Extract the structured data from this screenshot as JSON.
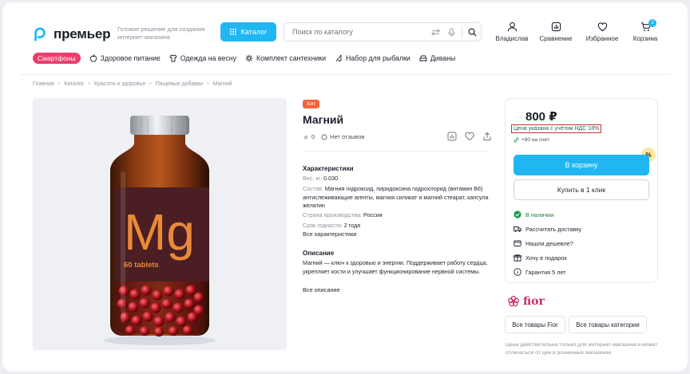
{
  "header": {
    "brand": "премьер",
    "tagline": "Готовое решение для создания интернет-магазина",
    "catalog_label": "Каталог",
    "search_placeholder": "Поиск по каталогу",
    "actions": {
      "profile": "Владислав",
      "compare": "Сравнение",
      "favorites": "Избранное",
      "cart": "Корзина",
      "cart_count": "2"
    }
  },
  "nav": {
    "items": [
      "Смартфоны",
      "Здоровое питание",
      "Одежда на весну",
      "Комплект сантехники",
      "Набор для рыбалки",
      "Диваны"
    ]
  },
  "breadcrumbs": [
    "Главная",
    "Каталог",
    "Красота и здоровье",
    "Пищевые добавки",
    "Магний"
  ],
  "image": {
    "label_big": "Mg",
    "label_small": "60 tablets"
  },
  "product": {
    "badge": "Хит",
    "title": "Магний",
    "rating": "0",
    "reviews": "Нет отзывов",
    "specs_title": "Характеристики",
    "specs": {
      "weight_k": "Вес, кг:",
      "weight_v": "0.030",
      "composition_k": "Состав:",
      "composition_v": "Магния гидроксид, пиридоксина гидрохлорид (витамин B6) антислеживающие агенты, магния силикат и магний стеарат, капсула желатин",
      "country_k": "Страна производства:",
      "country_v": "Россия",
      "shelf_k": "Срок годности:",
      "shelf_v": "2 года"
    },
    "all_specs": "Все характеристики",
    "description_title": "Описание",
    "description": "Магний — ключ к здоровью и энергии. Поддерживает работу сердца, укрепляет кости и улучшает функционирование нервной системы.",
    "all_description": "Все описание"
  },
  "buy": {
    "dots": "···",
    "price": "800 ₽",
    "vat_note": "Цена указана с учётом НДС 18%",
    "bonus": "+80 на счет",
    "discount_icon": "%",
    "add_to_cart": "В корзину",
    "one_click": "Купить в 1 клик",
    "features": [
      "В наличии",
      "Рассчитать доставку",
      "Нашли дешевле?",
      "Хочу в подарок",
      "Гарантия 5 лет"
    ]
  },
  "brand": {
    "name": "fior",
    "all_brand": "Все товары Fior",
    "all_category": "Все товары категории"
  },
  "disclaimer": "Цена действительна только для интернет-магазина и может отличаться от цен в розничных магазинах",
  "colors": {
    "accent": "#20b6f2",
    "hit": "#f2643a",
    "pill": "#ea3e6e",
    "stock": "#1a7f3c",
    "vat_border": "#c1352c"
  }
}
